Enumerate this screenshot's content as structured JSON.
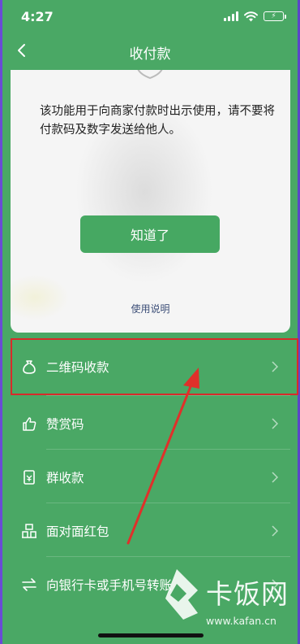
{
  "status_bar": {
    "time": "4:27",
    "icons": [
      "signal-icon",
      "wifi-icon",
      "battery-charging-icon"
    ]
  },
  "nav": {
    "title": "收付款",
    "back_icon": "chevron-left-icon"
  },
  "dialog": {
    "message": "该功能用于向商家付款时出示使用，请不要将付款码及数字发送给他人。",
    "ok_label": "知道了",
    "help_link": "使用说明"
  },
  "menu": {
    "items": [
      {
        "label": "二维码收款",
        "icon": "money-bag-icon"
      },
      {
        "label": "赞赏码",
        "icon": "thumbs-up-icon"
      },
      {
        "label": "群收款",
        "icon": "group-payment-icon"
      },
      {
        "label": "面对面红包",
        "icon": "red-packet-icon"
      },
      {
        "label": "向银行卡或手机号转账",
        "icon": "transfer-icon"
      }
    ]
  },
  "watermark": {
    "text": "卡饭网",
    "url": "www.kafan.cn"
  },
  "colors": {
    "background": "#4aa865",
    "button": "#46a862",
    "highlight": "#d82a2a",
    "link": "#3d4f78"
  }
}
